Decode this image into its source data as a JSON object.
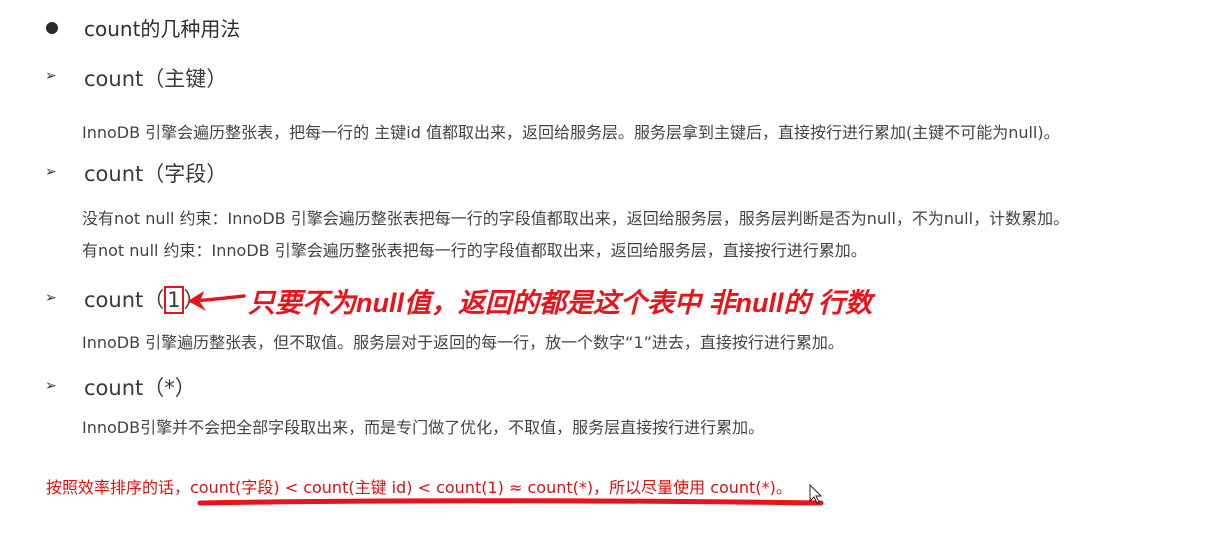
{
  "title": "count的几种用法",
  "sections": [
    {
      "label_prefix": "count（",
      "label_arg": "主键",
      "label_suffix": "）",
      "lines": [
        "InnoDB 引擎会遍历整张表，把每一行的 主键id 值都取出来，返回给服务层。服务层拿到主键后，直接按行进行累加(主键不可能为null)。"
      ]
    },
    {
      "label_prefix": "count（",
      "label_arg": "字段",
      "label_suffix": "）",
      "lines": [
        "没有not null 约束：InnoDB 引擎会遍历整张表把每一行的字段值都取出来，返回给服务层，服务层判断是否为null，不为null，计数累加。",
        "有not null 约束：InnoDB 引擎会遍历整张表把每一行的字段值都取出来，返回给服务层，直接按行进行累加。"
      ]
    },
    {
      "label_prefix": "count（",
      "label_arg": "1",
      "label_suffix": "）",
      "lines": [
        "InnoDB 引擎遍历整张表，但不取值。服务层对于返回的每一行，放一个数字“1”进去，直接按行进行累加。"
      ]
    },
    {
      "label_prefix": "count（",
      "label_arg": "*",
      "label_suffix": "）",
      "lines": [
        "InnoDB引擎并不会把全部字段取出来，而是专门做了优化，不取值，服务层直接按行进行累加。"
      ]
    }
  ],
  "annotation": "只要不为null值，返回的都是这个表中 非null的 行数",
  "summary": "按照效率排序的话，count(字段) < count(主键 id) < count(1) ≈ count(*)，所以尽量使用 count(*)。",
  "colors": {
    "annotation": "#e8141b",
    "summary": "#e01010"
  }
}
